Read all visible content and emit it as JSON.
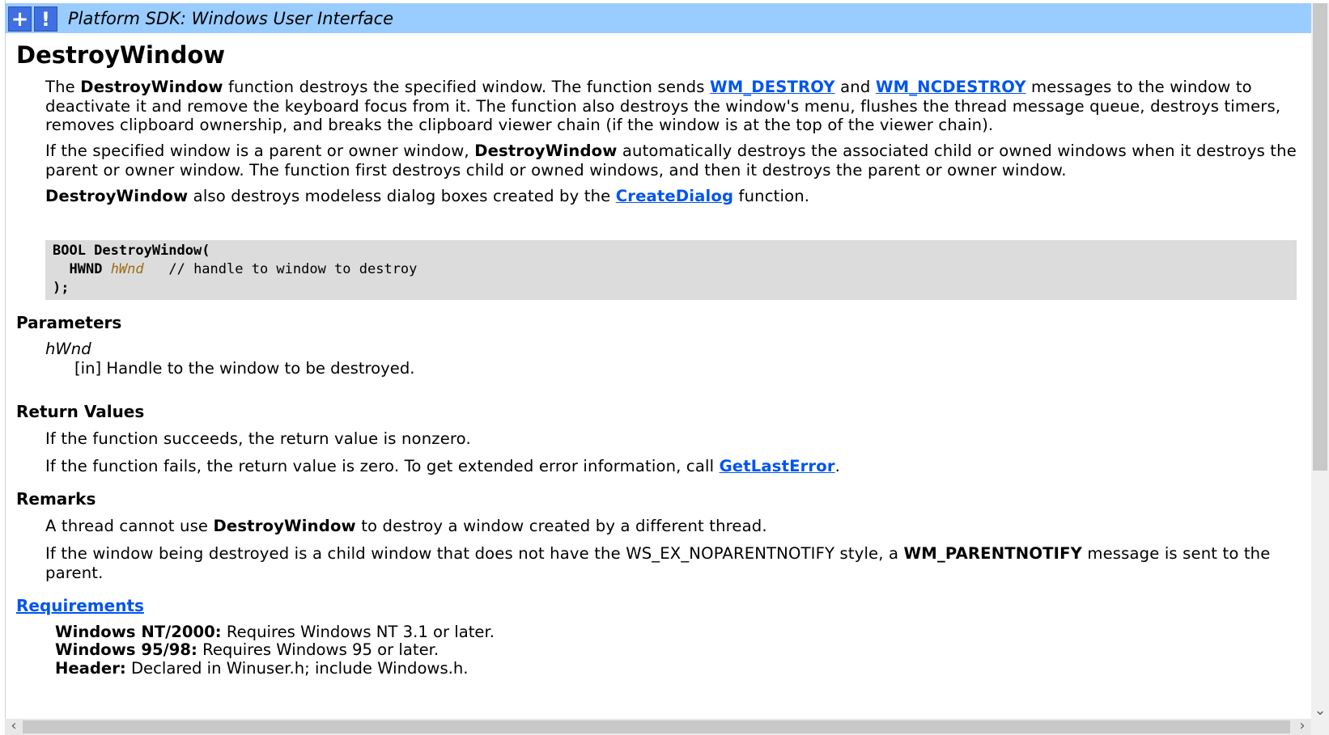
{
  "header": {
    "plus_icon": "+",
    "exclaim_icon": "!",
    "title": "Platform SDK: Windows User Interface"
  },
  "page": {
    "title": "DestroyWindow",
    "intro": {
      "p1_a": "The ",
      "p1_fn": "DestroyWindow",
      "p1_b": " function destroys the specified window. The function sends ",
      "p1_link1": "WM_DESTROY",
      "p1_c": " and ",
      "p1_link2": "WM_NCDESTROY",
      "p1_d": " messages to the window to deactivate it and remove the keyboard focus from it. The function also destroys the window's menu, flushes the thread message queue, destroys timers, removes clipboard ownership, and breaks the clipboard viewer chain (if the window is at the top of the viewer chain).",
      "p2_a": "If the specified window is a parent or owner window, ",
      "p2_fn": "DestroyWindow",
      "p2_b": " automatically destroys the associated child or owned windows when it destroys the parent or owner window. The function first destroys child or owned windows, and then it destroys the parent or owner window.",
      "p3_fn": "DestroyWindow",
      "p3_a": " also destroys modeless dialog boxes created by the ",
      "p3_link": "CreateDialog",
      "p3_b": " function."
    },
    "code": {
      "line1": "BOOL DestroyWindow(",
      "line2_type": "HWND",
      "line2_param": "hWnd",
      "line2_comment": "// handle to window to destroy",
      "line3": ");"
    },
    "parameters": {
      "heading": "Parameters",
      "name": "hWnd",
      "desc": "[in] Handle to the window to be destroyed."
    },
    "return_values": {
      "heading": "Return Values",
      "p1": "If the function succeeds, the return value is nonzero.",
      "p2_a": "If the function fails, the return value is zero. To get extended error information, call ",
      "p2_link": "GetLastError",
      "p2_b": "."
    },
    "remarks": {
      "heading": "Remarks",
      "p1_a": "A thread cannot use ",
      "p1_fn": "DestroyWindow",
      "p1_b": " to destroy a window created by a different thread.",
      "p2_a": "If the window being destroyed is a child window that does not have the WS_EX_NOPARENTNOTIFY style, a ",
      "p2_msg": "WM_PARENTNOTIFY",
      "p2_b": " message is sent to the parent."
    },
    "requirements": {
      "heading": "Requirements",
      "rows": [
        {
          "label": "Windows NT/2000:",
          "value": " Requires Windows NT 3.1 or later."
        },
        {
          "label": "Windows 95/98:",
          "value": " Requires Windows 95 or later."
        },
        {
          "label": "Header:",
          "value": " Declared in Winuser.h; include Windows.h."
        }
      ]
    }
  },
  "scrollbars": {
    "up_arrow": "⌃",
    "down_arrow": "⌄",
    "left_arrow": "‹",
    "right_arrow": "›"
  }
}
